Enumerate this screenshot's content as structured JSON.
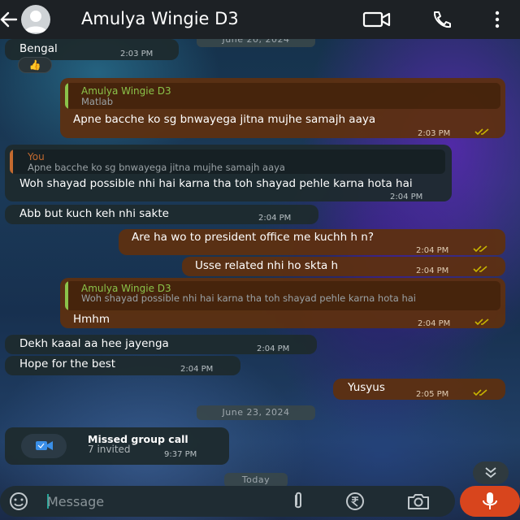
{
  "header": {
    "contact_name": "Amulya Wingie D3"
  },
  "dates": {
    "top": "June 20, 2024",
    "mid": "June 23, 2024",
    "bottom": "Today"
  },
  "messages": [
    {
      "dir": "in",
      "text": "Bengal",
      "time": "2:03 PM",
      "reaction": "👍"
    },
    {
      "dir": "out",
      "quote_name": "Amulya Wingie D3",
      "quote_text": "Matlab",
      "text": "Apne bacche ko sg bnwayega jitna mujhe samajh aaya",
      "time": "2:03 PM"
    },
    {
      "dir": "in",
      "quote_name": "You",
      "quote_text": "Apne bacche ko sg bnwayega jitna mujhe samajh aaya",
      "text": "Woh shayad possible nhi hai karna tha toh shayad pehle karna hota hai",
      "time": "2:04 PM"
    },
    {
      "dir": "in",
      "text": "Abb but kuch keh nhi sakte",
      "time": "2:04 PM"
    },
    {
      "dir": "out",
      "text": "Are ha wo to president office me kuchh h n?",
      "time": "2:04 PM"
    },
    {
      "dir": "out",
      "text": "Usse related nhi ho skta h",
      "time": "2:04 PM"
    },
    {
      "dir": "out",
      "quote_name": "Amulya Wingie D3",
      "quote_text": "Woh shayad possible nhi hai karna tha toh shayad pehle karna hota hai",
      "text": "Hmhm",
      "time": "2:04 PM"
    },
    {
      "dir": "in",
      "text": "Dekh kaaal aa hee jayenga",
      "time": "2:04 PM"
    },
    {
      "dir": "in",
      "text": "Hope for the best",
      "time": "2:04 PM"
    },
    {
      "dir": "out",
      "text": "Yusyus",
      "time": "2:05 PM"
    }
  ],
  "missed_call": {
    "title": "Missed group call",
    "subtitle": "7 invited",
    "time": "9:37 PM"
  },
  "composer": {
    "placeholder": "Message"
  },
  "icons": {
    "back": "back-arrow-icon",
    "video": "video-call-icon",
    "call": "phone-icon",
    "menu": "more-vert-icon",
    "emoji": "emoji-icon",
    "attach": "paperclip-icon",
    "payment": "rupee-payment-icon",
    "camera": "camera-icon",
    "mic": "microphone-icon",
    "scroll": "double-chevron-down-icon"
  },
  "colors": {
    "outgoing_bubble": "#5d3010",
    "incoming_bubble": "#1e2a2e",
    "quote_in_name": "#c46a2f",
    "quote_out_name": "#8bc34a",
    "read_tick": "#c8b400",
    "mic_button": "#d8451d"
  }
}
